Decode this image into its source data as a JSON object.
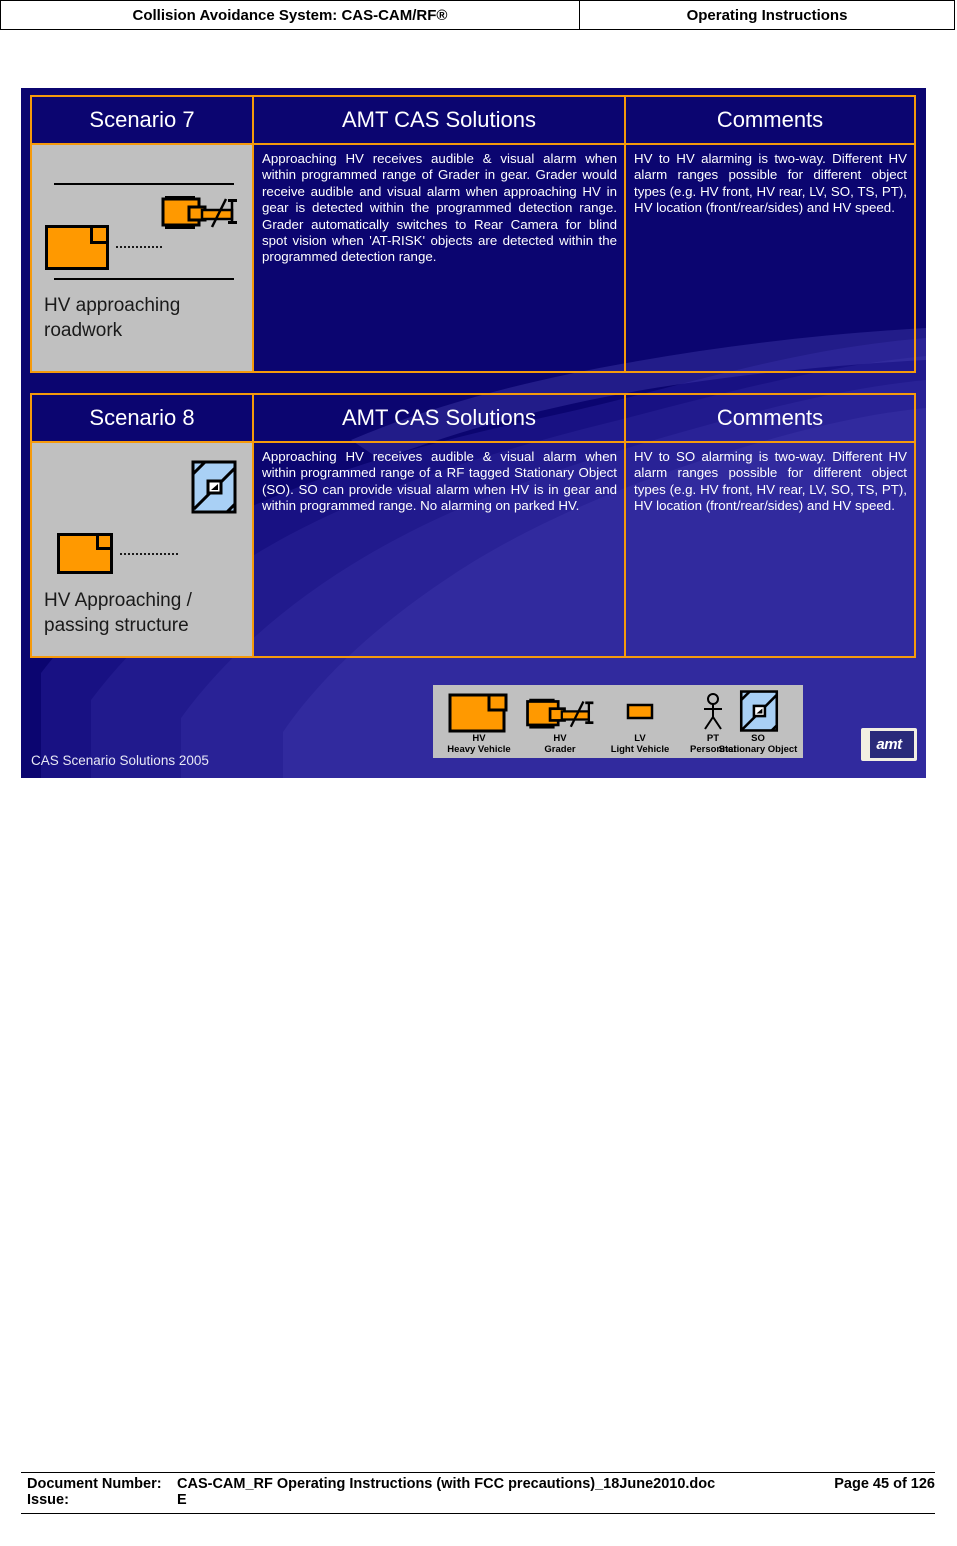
{
  "page_header": {
    "left_title": "Collision Avoidance System: CAS-CAM/RF®",
    "right_title": "Operating Instructions"
  },
  "slide": {
    "footer_text": "CAS Scenario Solutions 2005",
    "logo_text": "amt",
    "colors": {
      "background_navy": "#0b0570",
      "border_orange": "#f59a0c",
      "diagram_gray": "#c0c0c0",
      "vehicle_orange": "#ff9900",
      "structure_blue": "#a9d0f5"
    },
    "tables": [
      {
        "headers": {
          "scenario": "Scenario 7",
          "solutions": "AMT CAS Solutions",
          "comments": "Comments"
        },
        "diagram_caption": "HV approaching roadwork",
        "solutions_text": "Approaching HV receives audible & visual alarm when within programmed range of Grader in gear.  Grader would receive audible and visual alarm when approaching HV in gear is detected within the programmed detection range. Grader automatically switches to Rear Camera for blind spot vision when 'AT-RISK' objects are detected within the programmed detection range.",
        "comments_text": "HV to HV alarming is two-way. Different HV alarm ranges possible for different object types (e.g. HV front, HV rear, LV, SO, TS, PT), HV location (front/rear/sides) and HV speed."
      },
      {
        "headers": {
          "scenario": "Scenario 8",
          "solutions": "AMT CAS Solutions",
          "comments": "Comments"
        },
        "diagram_caption": "HV Approaching / passing structure",
        "solutions_text": "Approaching HV receives audible & visual alarm when within programmed range of a RF tagged Stationary Object (SO).  SO can provide visual alarm when HV is in gear and within programmed range. No alarming on parked HV.",
        "comments_text": "HV to SO alarming is two-way. Different HV alarm ranges possible for different object types (e.g. HV front, HV rear, LV, SO, TS, PT), HV location (front/rear/sides) and HV speed."
      }
    ],
    "legend": {
      "items": [
        {
          "icon": "heavy-vehicle-icon",
          "abbr": "HV",
          "name": "Heavy Vehicle"
        },
        {
          "icon": "grader-icon",
          "abbr": "HV",
          "name": "Grader"
        },
        {
          "icon": "light-vehicle-icon",
          "abbr": "LV",
          "name": "Light Vehicle"
        },
        {
          "icon": "personnel-icon",
          "abbr": "PT",
          "name": "Personnel"
        },
        {
          "icon": "stationary-object-icon",
          "abbr": "SO",
          "name": "Stationary Object"
        }
      ]
    }
  },
  "doc_footer": {
    "doc_number_label": "Document Number:",
    "doc_number_value": "CAS-CAM_RF Operating Instructions (with FCC precautions)_18June2010.doc",
    "page_value": "Page 45 of  126",
    "issue_label": "Issue:",
    "issue_value": "E"
  }
}
